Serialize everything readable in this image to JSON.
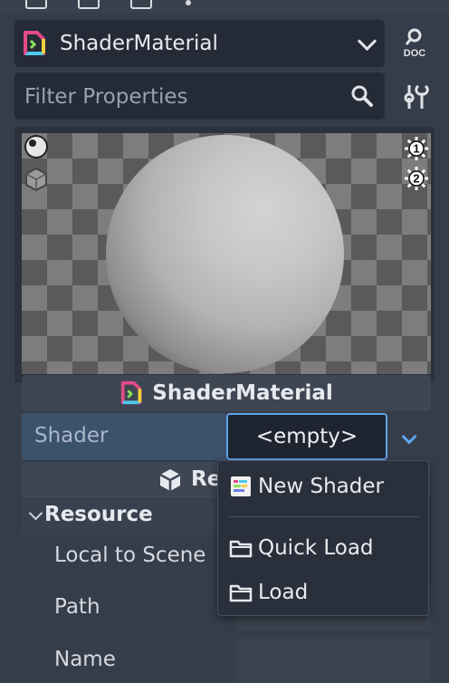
{
  "inspector": {
    "resource_type": "ShaderMaterial",
    "doc_label": "DOC",
    "filter_placeholder": "Filter Properties"
  },
  "preview": {
    "material_name": "ShaderMaterial",
    "light_1_label": "1",
    "light_2_label": "2"
  },
  "shader_property": {
    "label": "Shader",
    "value": "<empty>"
  },
  "resource_band": {
    "label": "Re"
  },
  "section": {
    "title": "Resource",
    "properties": [
      "Local to Scene",
      "Path",
      "Name"
    ]
  },
  "context_menu": {
    "items": [
      {
        "label": "New Shader",
        "icon": "shader-file-icon"
      },
      {
        "label": "Quick Load",
        "icon": "folder-icon"
      },
      {
        "label": "Load",
        "icon": "folder-icon"
      }
    ]
  },
  "colors": {
    "panel_bg": "#363d4a",
    "field_bg": "#252b36",
    "accent": "#5ea4ec",
    "highlight_row": "#3b526c"
  }
}
